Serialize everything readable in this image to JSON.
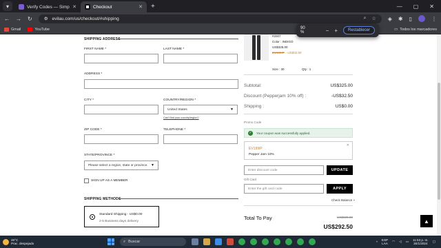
{
  "browser": {
    "tabs": [
      {
        "title": "Verify Codes — SimplyCodes",
        "active": false,
        "favicon_color": "#7b5cd6"
      },
      {
        "title": "Checkout",
        "active": true,
        "favicon_color": "#111111"
      }
    ],
    "url": "evilau.com/us/checkout/#shipping",
    "bookmarks": [
      {
        "label": "Gmail",
        "icon_color": "#e04a3a"
      },
      {
        "label": "YouTube",
        "icon_color": "#ff0000"
      }
    ],
    "bookmarks_right": "Todos los marcadores",
    "zoom": {
      "value": "90 %",
      "minus": "−",
      "plus": "+",
      "reset_label": "Restablecer"
    }
  },
  "shipping": {
    "section_title": "SHIPPING ADDRESS",
    "first_name_label": "FIRST NAME *",
    "last_name_label": "LAST NAME *",
    "address_label": "ADDRESS *",
    "city_label": "CITY *",
    "country_label": "COUNTRY/REGION *",
    "country_value": "United States",
    "country_link": "Can't find your country/region?",
    "zip_label": "ZIP CODE *",
    "phone_label": "TELEPHONE *",
    "state_label": "STATE/PROVINCE *",
    "state_placeholder": "Please select a region, state or province.",
    "signup_label": "SIGN UP AS A MEMBER"
  },
  "methods": {
    "section_title": "SHIPPING METHODS",
    "option_title": "Standard Shipping - US$0.00",
    "option_sub": "2-5 Business days delivery"
  },
  "product": {
    "sku": "#2007",
    "color": "Color : INDIGO",
    "price": "US$325.00",
    "sale_code": "EV199IP",
    "sale_price": "-US$32.50",
    "size": "Size : 30",
    "qty": "Qty : 1"
  },
  "summary": {
    "subtotal_label": "Subtotal:",
    "subtotal_value": "US$325.00",
    "discount_label": "Discount (Pepperjam 10% off) :",
    "discount_value": "-US$32.50",
    "shipping_label": "Shipping :",
    "shipping_value": "US$0.00",
    "promo_label": "Promo Code",
    "coupon_success": "Your coupon was successfully applied.",
    "coupon_code": "EV199IP",
    "coupon_desc": "Pepper Jam 10%",
    "discount_placeholder": "Enter discount code",
    "update_label": "UPDATE",
    "gift_label": "Gift Card",
    "gift_placeholder": "Enter the gift card code",
    "apply_label": "APPLY",
    "check_balance": "Check Balance »",
    "total_label": "Total To Pay",
    "total_old": "US$325.00",
    "total_value": "US$292.50"
  },
  "taskbar": {
    "temp": "26°C",
    "weather": "Prac. despejado",
    "search": "Buscar",
    "lang": "ESP",
    "layout": "LAA",
    "time": "11:53 p. m.",
    "date": "30/1/2024"
  }
}
